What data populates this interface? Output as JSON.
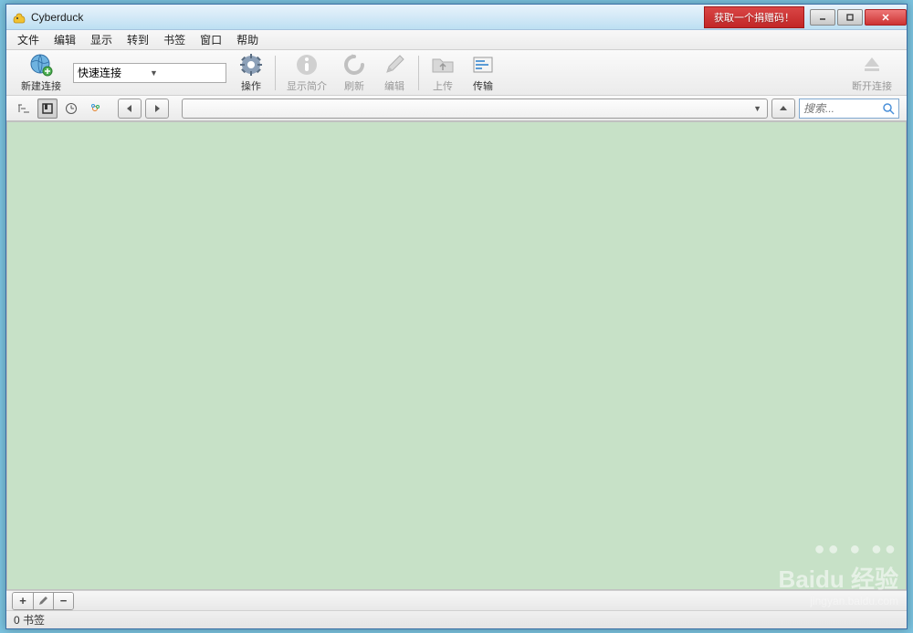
{
  "titlebar": {
    "title": "Cyberduck",
    "donate_label": "获取一个捐赠码！"
  },
  "menubar": {
    "items": [
      "文件",
      "编辑",
      "显示",
      "转到",
      "书签",
      "窗口",
      "帮助"
    ]
  },
  "toolbar": {
    "new_connection_label": "新建连接",
    "quick_connect_value": "快速连接",
    "action_label": "操作",
    "info_label": "显示简介",
    "refresh_label": "刷新",
    "edit_label": "编辑",
    "upload_label": "上传",
    "transfer_label": "传输",
    "disconnect_label": "断开连接"
  },
  "search": {
    "placeholder": "搜索..."
  },
  "statusbar": {
    "text": "0 书签"
  },
  "watermark": {
    "brand": "Baidu 经验",
    "url": "jingyan.baidu.com"
  }
}
